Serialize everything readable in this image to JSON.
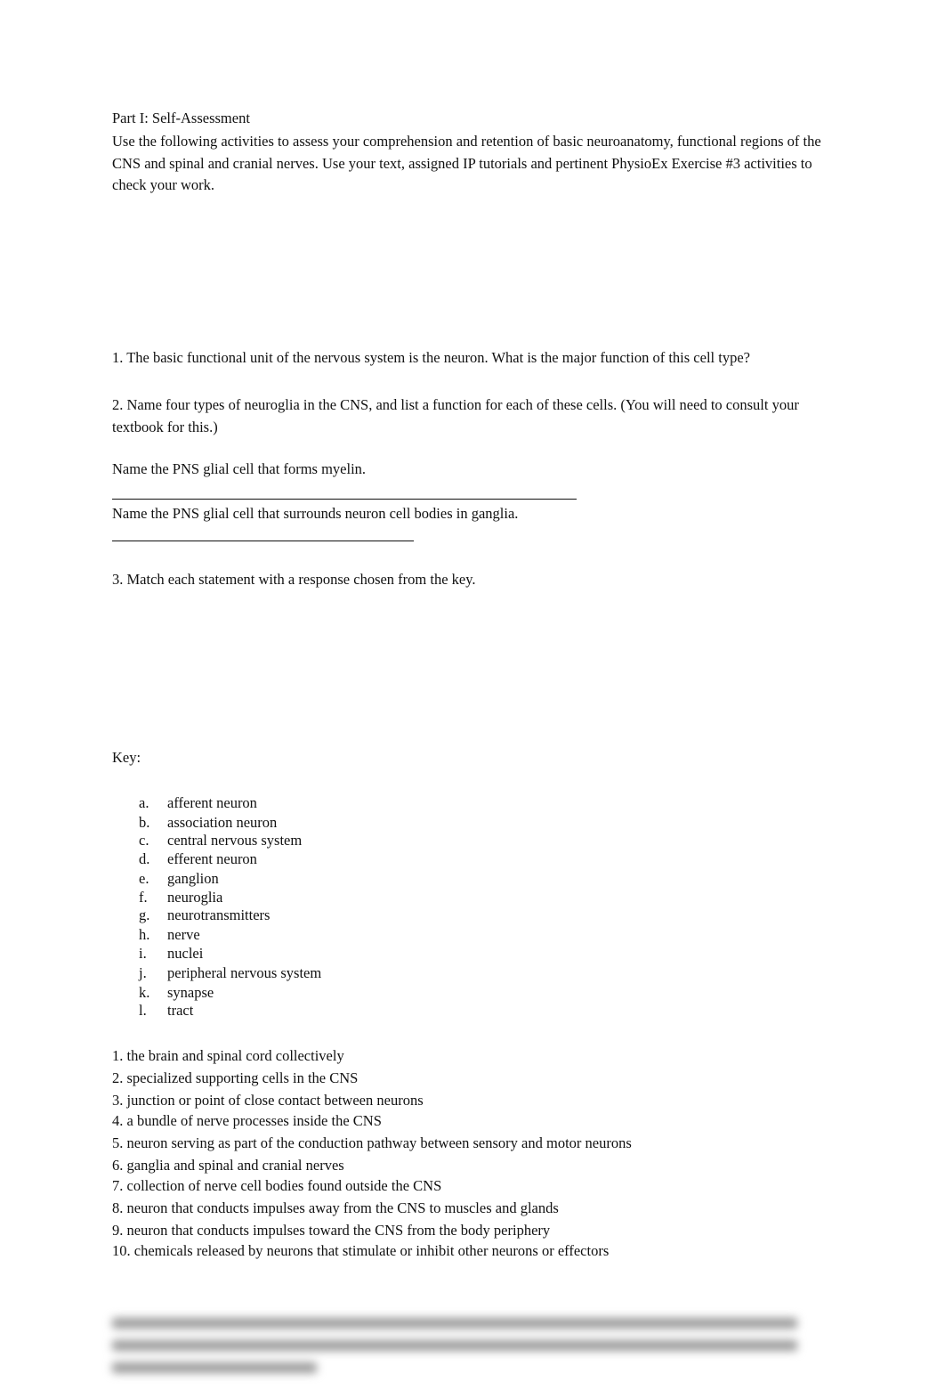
{
  "document": {
    "part_title": "Part I: Self-Assessment",
    "intro": "Use the following activities to assess your comprehension and retention of basic neuroanatomy, functional regions of the CNS and spinal and cranial nerves. Use your text, assigned IP tutorials and pertinent PhysioEx Exercise #3 activities to check your work.",
    "q1": "1. The basic functional unit of the nervous system is the neuron. What is the major function of this cell type?",
    "q2": "2. Name four types of neuroglia in the CNS, and list a function for each of these cells. (You will need to consult your textbook for this.)",
    "q2_myelin": "Name the PNS glial cell that forms myelin.",
    "q2_ganglia": "Name the PNS glial cell that surrounds neuron cell bodies in ganglia.",
    "q3": "3. Match each statement with a response chosen from the key.",
    "key_label": "Key:",
    "key": [
      {
        "letter": "a.",
        "term": "afferent neuron"
      },
      {
        "letter": "b.",
        "term": "association neuron"
      },
      {
        "letter": "c.",
        "term": "central nervous system"
      },
      {
        "letter": "d.",
        "term": "efferent neuron"
      },
      {
        "letter": "e.",
        "term": "ganglion"
      },
      {
        "letter": "f.",
        "term": "neuroglia"
      },
      {
        "letter": "g.",
        "term": "neurotransmitters"
      },
      {
        "letter": "h.",
        "term": "nerve"
      },
      {
        "letter": "i.",
        "term": "nuclei"
      },
      {
        "letter": "j.",
        "term": "peripheral nervous system"
      },
      {
        "letter": "k.",
        "term": "synapse"
      },
      {
        "letter": "l.",
        "term": "tract"
      }
    ],
    "statements": [
      "1. the brain and spinal cord collectively",
      "2. specialized supporting cells in the CNS",
      "3. junction or point of close contact between neurons",
      "4. a bundle of nerve processes inside the CNS",
      "5. neuron serving as part of the conduction pathway between sensory and motor neurons",
      "6. ganglia and spinal and cranial nerves",
      "7. collection of nerve cell bodies found outside the CNS",
      "8. neuron that conducts impulses away from the CNS to muscles and glands",
      "9. neuron that conducts impulses toward the CNS from the body periphery",
      "10. chemicals released by neurons that stimulate or inhibit other neurons or effectors"
    ]
  }
}
